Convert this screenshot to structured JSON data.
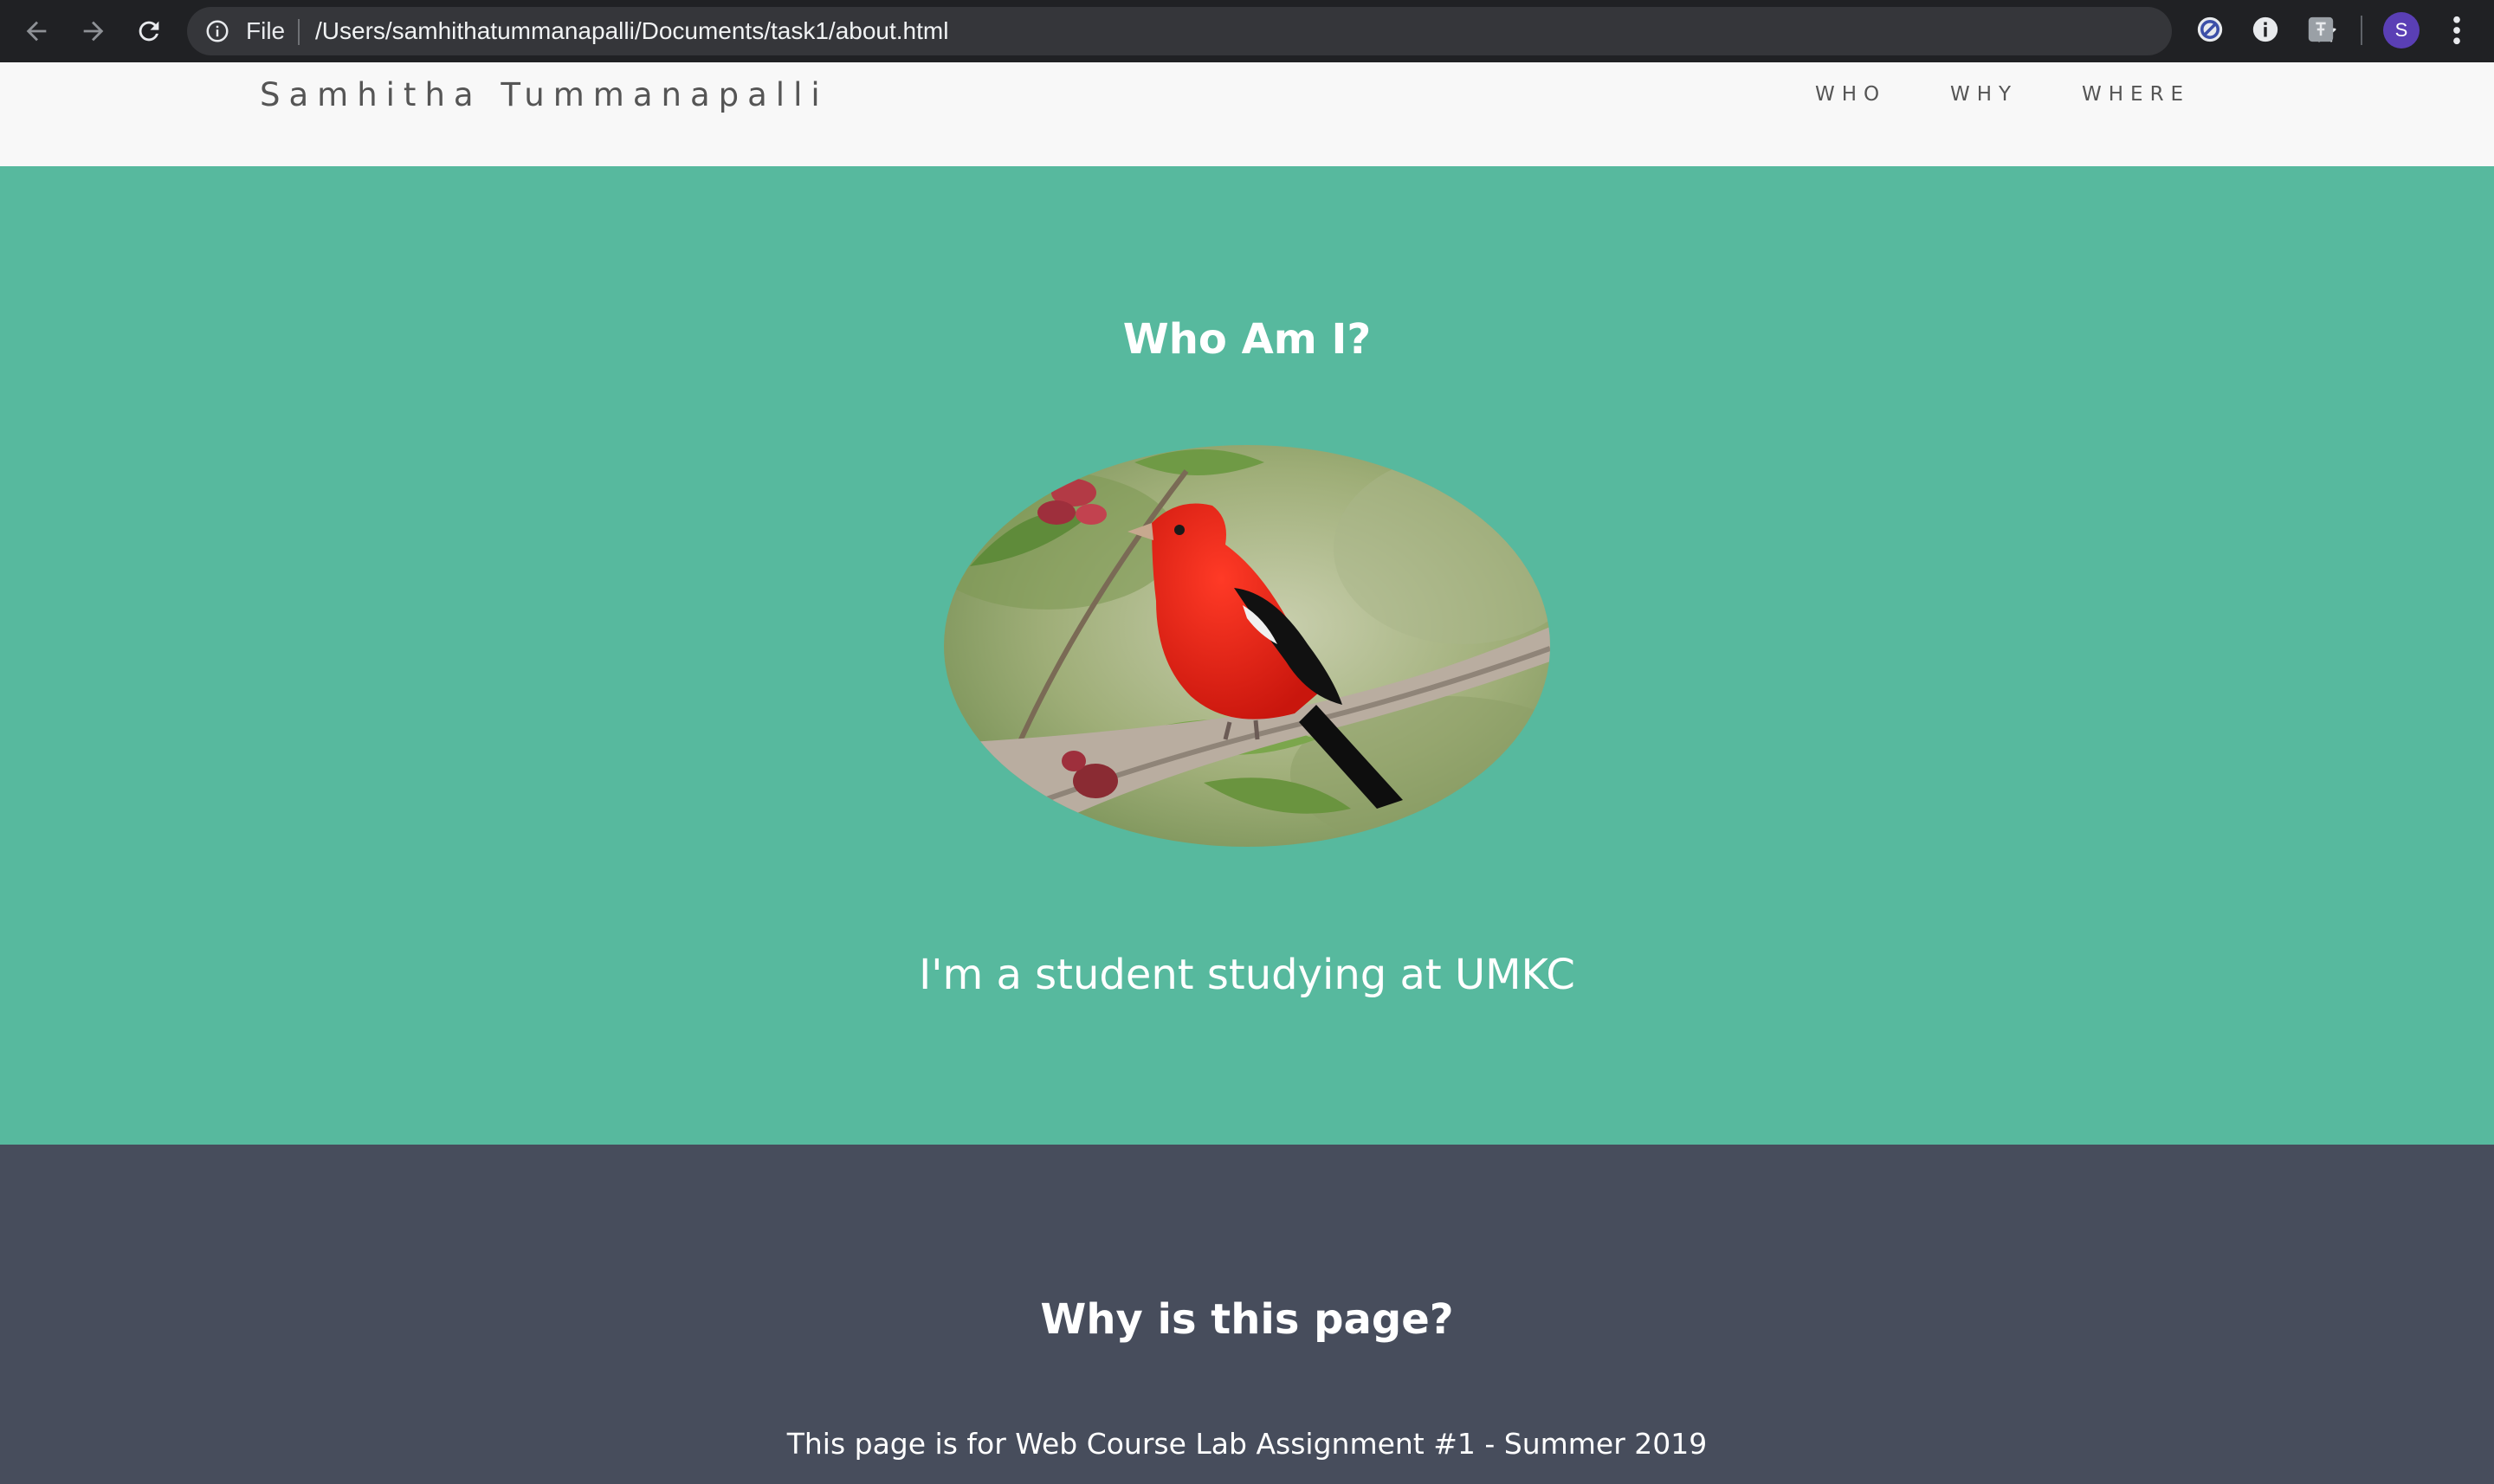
{
  "browser": {
    "scheme_label": "File",
    "url": "/Users/samhithatummanapalli/Documents/task1/about.html",
    "profile_initial": "S",
    "icons": [
      "back-icon",
      "forward-icon",
      "reload-icon",
      "info-icon",
      "star-icon",
      "block-extension-icon",
      "info-extension-icon",
      "translate-extension-icon",
      "menu-icon"
    ]
  },
  "header": {
    "brand": "Samhitha Tummanapalli",
    "nav": [
      "WHO",
      "WHY",
      "WHERE"
    ]
  },
  "who": {
    "title": "Who Am I?",
    "image_alt": "scarlet-tanager-bird-image",
    "text": "I'm a student studying at UMKC"
  },
  "why": {
    "title": "Why is this page?",
    "text": "This page is for Web Course Lab Assignment #1 - Summer 2019"
  },
  "colors": {
    "chrome": "#202124",
    "header_bg": "#f8f8f8",
    "who_bg": "#57b99e",
    "why_bg": "#474d5c",
    "avatar": "#5a3fb5"
  }
}
